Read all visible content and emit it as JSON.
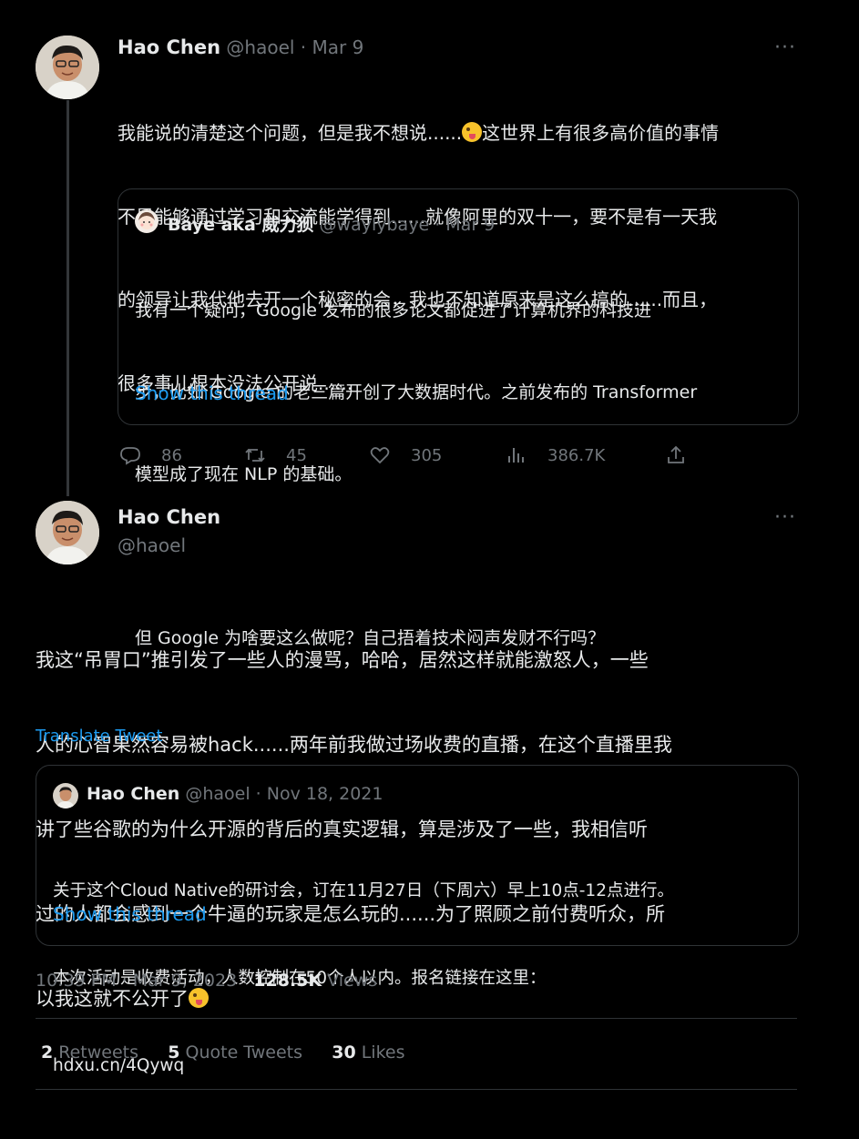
{
  "tweet1": {
    "name": "Hao Chen",
    "handle": "@haoel",
    "sep": "·",
    "date": "Mar 9",
    "text_lines": [
      "我能说的清楚这个问题，但是我不想说......",
      "这世界上有很多高价值的事情",
      "不是能够通过学习和交流能学得到......就像阿里的双十一，要不是有一天我",
      "的领导让我代他去开一个秘密的会，我也不知道原来是这么搞的......而且，",
      "很多事儿根本没法公开说......"
    ],
    "emoji": "winking-face-with-tongue",
    "quote": {
      "name": "Baye aka 威力狈",
      "handle": "@waylybaye",
      "sep": "·",
      "date": "Mar 9",
      "lines": [
        "我有一个疑问，Google 发布的很多论文都促进了计算机界的科技进",
        "步，比如 Google 的老三篇开创了大数据时代。之前发布的 Transformer",
        "模型成了现在 NLP 的基础。",
        "",
        "但 Google 为啥要这么做呢？自己捂着技术闷声发财不行吗？"
      ],
      "show_thread": "Show this thread"
    },
    "actions": {
      "replies": "86",
      "retweets": "45",
      "likes": "305",
      "views": "386.7K"
    }
  },
  "tweet2": {
    "name": "Hao Chen",
    "handle": "@haoel",
    "text_lines": [
      "我这“吊胃口”推引发了一些人的漫骂，哈哈，居然这样就能激怒人，一些",
      "人的心智果然容易被hack......两年前我做过场收费的直播，在这个直播里我",
      "讲了些谷歌的为什么开源的背后的真实逻辑，算是涉及了一些，我相信听",
      "过的人都会感到一个牛逼的玩家是怎么玩的......为了照顾之前付费听众，所",
      "以我这就不公开了"
    ],
    "emoji": "winking-face-with-tongue",
    "translate": "Translate Tweet",
    "quote": {
      "name": "Hao Chen",
      "handle": "@haoel",
      "sep": "·",
      "date": "Nov 18, 2021",
      "lines": [
        "关于这个Cloud Native的研讨会，订在11月27日（下周六）早上10点-12点进行。",
        "本次活动是收费活动，人数控制在50个人以内。报名链接在这里：",
        "hdxu.cn/4Qywq"
      ],
      "show_thread": "Show this thread"
    },
    "timestamp": "10:39 PM · Mar 9, 2023 · ",
    "views_count": "128.5K",
    "views_label": " Views",
    "stats": [
      {
        "num": "2",
        "label": " Retweets"
      },
      {
        "num": "5",
        "label": " Quote Tweets"
      },
      {
        "num": "30",
        "label": " Likes"
      }
    ]
  },
  "more_menu": "···",
  "colors": {
    "background": "#000000",
    "text": "#e7e9ea",
    "muted": "#71767b",
    "accent": "#1d9bf0",
    "border": "#2f3336"
  }
}
